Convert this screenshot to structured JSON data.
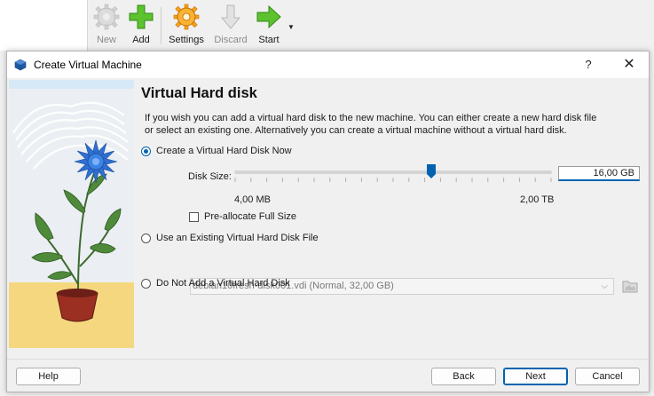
{
  "toolbar": {
    "buttons": [
      {
        "label": "New",
        "icon": "new-gear-icon",
        "enabled": false
      },
      {
        "label": "Add",
        "icon": "add-plus-icon",
        "enabled": true
      },
      {
        "label": "Settings",
        "icon": "settings-gear-icon",
        "enabled": true
      },
      {
        "label": "Discard",
        "icon": "discard-arrow-icon",
        "enabled": false
      },
      {
        "label": "Start",
        "icon": "start-arrow-icon",
        "enabled": true
      }
    ]
  },
  "dialog": {
    "title": "Create Virtual Machine",
    "help_glyph": "?",
    "close_glyph": "✕",
    "page_title": "Virtual Hard disk",
    "description": "If you wish you can add a virtual hard disk to the new machine. You can either create a new hard disk file or select an existing one. Alternatively you can create a virtual machine without a virtual hard disk.",
    "options": {
      "create_now": "Create a Virtual Hard Disk Now",
      "use_existing": "Use an Existing Virtual Hard Disk File",
      "do_not_add": "Do Not Add a Virtual Hard Disk"
    },
    "selected_option": "create_now",
    "disk_size": {
      "label": "Disk Size:",
      "value": "16,00 GB",
      "min_label": "4,00 MB",
      "max_label": "2,00 TB",
      "slider_fraction": 0.62
    },
    "preallocate": {
      "label": "Pre-allocate Full Size",
      "checked": false
    },
    "existing_file": "debian10fresh-disk001.vdi (Normal, 32,00 GB)",
    "buttons": {
      "help": "Help",
      "back": "Back",
      "next": "Next",
      "cancel": "Cancel"
    }
  },
  "colors": {
    "accent": "#0063b1",
    "illustration_floor": "#f5d77f",
    "flower": "#2f6fd1"
  }
}
